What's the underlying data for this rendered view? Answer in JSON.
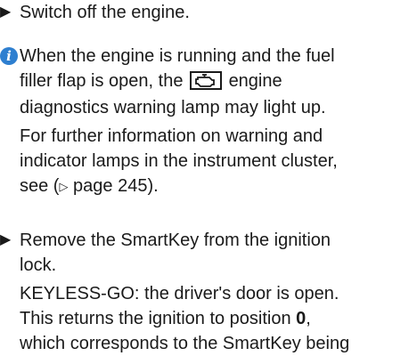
{
  "step1": {
    "text": "Switch off the engine."
  },
  "note": {
    "line1": "When the engine is running and the fuel",
    "line2_a": "filler flap is open, the",
    "line2_b": "engine",
    "line3": "diagnostics warning lamp may light up.",
    "para2_line1": "For further information on warning and",
    "para2_line2": "indicator lamps in the instrument cluster,",
    "para2_line3_a": "see (",
    "para2_line3_arrow": "▷",
    "para2_line3_b": "page 245)."
  },
  "step2": {
    "line1": "Remove the SmartKey from the ignition",
    "line2": "lock.",
    "line3": "KEYLESS-GO: the driver's door is open.",
    "line4": "This returns the ignition to position",
    "line4_bold": "0",
    "line5": "which corresponds to the SmartKey being"
  },
  "icons": {
    "bullet": "bullet-triangle-icon",
    "info": "info-icon",
    "lamp": "engine-diagnostics-icon"
  },
  "colors": {
    "info": "#2e7fd0",
    "text": "#1a1a1a"
  }
}
